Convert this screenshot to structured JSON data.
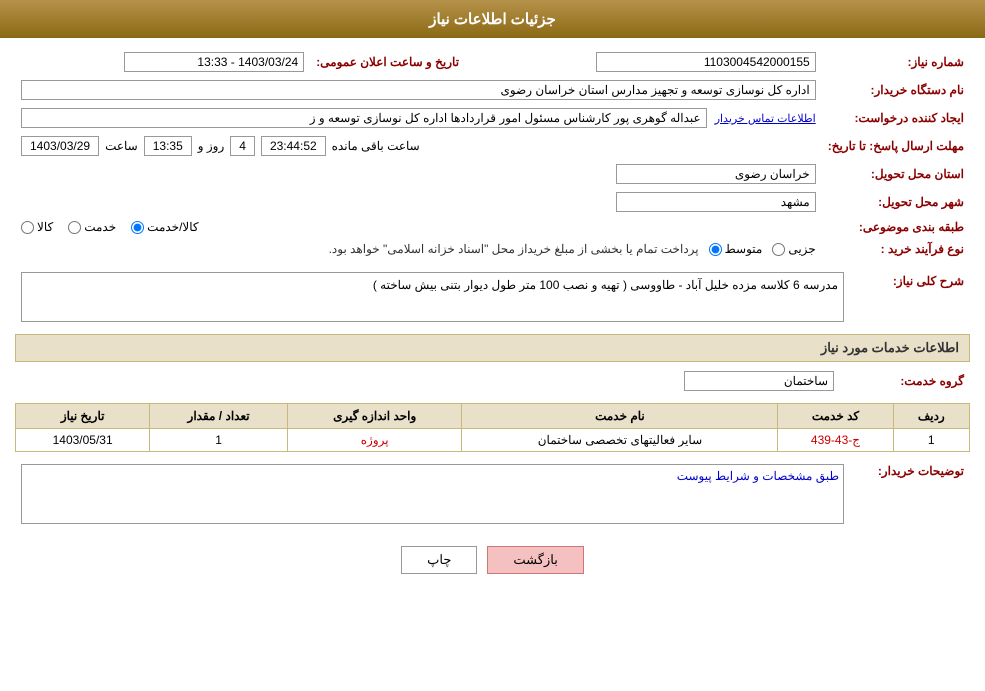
{
  "header": {
    "title": "جزئیات اطلاعات نیاز"
  },
  "fields": {
    "need_number_label": "شماره نیاز:",
    "need_number_value": "1103004542000155",
    "org_name_label": "نام دستگاه خریدار:",
    "org_name_value": "اداره کل نوسازی  توسعه و تجهیز مدارس استان خراسان رضوی",
    "creator_label": "ایجاد کننده درخواست:",
    "creator_value": "عبداله گوهری پور کارشناس مسئول امور قراردادها  اداره کل نوسازی  توسعه و ز",
    "contact_info_link": "اطلاعات تماس خریدار",
    "deadline_label": "مهلت ارسال پاسخ: تا تاریخ:",
    "deadline_date": "1403/03/29",
    "deadline_time_label": "ساعت",
    "deadline_time": "13:35",
    "deadline_day_label": "روز و",
    "deadline_days": "4",
    "deadline_countdown_label": "ساعت باقی مانده",
    "deadline_countdown": "23:44:52",
    "announce_label": "تاریخ و ساعت اعلان عمومی:",
    "announce_value": "1403/03/24 - 13:33",
    "province_label": "استان محل تحویل:",
    "province_value": "خراسان رضوی",
    "city_label": "شهر محل تحویل:",
    "city_value": "مشهد",
    "category_label": "طبقه بندی موضوعی:",
    "category_kala": "کالا",
    "category_khedmat": "خدمت",
    "category_kala_khedmat": "کالا/خدمت",
    "category_selected": "kala_khedmat",
    "purchase_type_label": "نوع فرآیند خرید :",
    "purchase_jozvi": "جزیی",
    "purchase_motavasset": "متوسط",
    "purchase_description": "پرداخت تمام یا بخشی از مبلغ خریداز محل \"اسناد خزانه اسلامی\" خواهد بود.",
    "need_desc_label": "شرح کلی نیاز:",
    "need_desc_value": "مدرسه 6 کلاسه مزده خلیل آباد - طاووسی ( تهیه و نصب 100 متر طول دیوار بتنی بیش ساخته )",
    "service_info_header": "اطلاعات خدمات مورد نیاز",
    "service_group_label": "گروه خدمت:",
    "service_group_value": "ساختمان",
    "table_headers": {
      "row_num": "ردیف",
      "service_code": "کد خدمت",
      "service_name": "نام خدمت",
      "unit": "واحد اندازه گیری",
      "count": "تعداد / مقدار",
      "date": "تاریخ نیاز"
    },
    "table_rows": [
      {
        "row_num": "1",
        "service_code": "ج-43-439",
        "service_name": "سایر فعالیتهای تخصصی ساختمان",
        "unit": "پروژه",
        "count": "1",
        "date": "1403/05/31"
      }
    ],
    "buyer_desc_label": "توضیحات خریدار:",
    "buyer_desc_value": "طبق مشخصات و شرایط پیوست",
    "btn_print": "چاپ",
    "btn_back": "بازگشت"
  }
}
